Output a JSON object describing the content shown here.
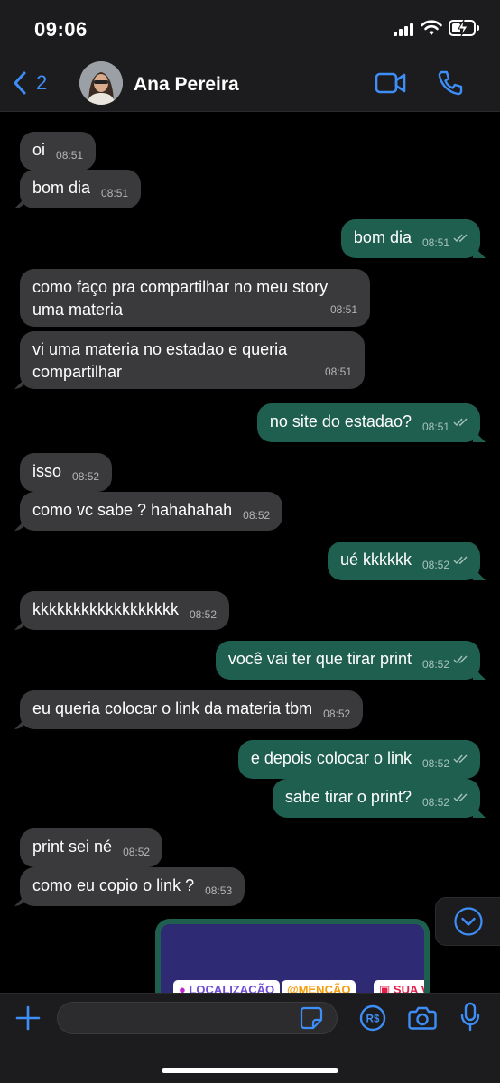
{
  "status_bar": {
    "time": "09:06"
  },
  "header": {
    "back_count": "2",
    "contact_name": "Ana Pereira"
  },
  "messages": [
    {
      "dir": "in",
      "text": "oi",
      "time": "08:51"
    },
    {
      "dir": "in",
      "text": "bom dia",
      "time": "08:51"
    },
    {
      "dir": "out",
      "text": "bom dia",
      "time": "08:51"
    },
    {
      "dir": "in",
      "text": "como faço pra compartilhar no meu story uma materia",
      "time": "08:51"
    },
    {
      "dir": "in",
      "text": "vi uma materia no estadao e queria compartilhar",
      "time": "08:51"
    },
    {
      "dir": "out",
      "text": "no site do estadao?",
      "time": "08:51"
    },
    {
      "dir": "in",
      "text": "isso",
      "time": "08:52"
    },
    {
      "dir": "in",
      "text": "como vc sabe ? hahahahah",
      "time": "08:52"
    },
    {
      "dir": "out",
      "text": "ué kkkkkk",
      "time": "08:52"
    },
    {
      "dir": "in",
      "text": "kkkkkkkkkkkkkkkkkk",
      "time": "08:52"
    },
    {
      "dir": "out",
      "text": "você vai ter que tirar print",
      "time": "08:52"
    },
    {
      "dir": "in",
      "text": "eu queria colocar o link da materia tbm",
      "time": "08:52"
    },
    {
      "dir": "out",
      "text": "e depois colocar o link",
      "time": "08:52"
    },
    {
      "dir": "out",
      "text": "sabe tirar o print?",
      "time": "08:52"
    },
    {
      "dir": "in",
      "text": "print sei né",
      "time": "08:52"
    },
    {
      "dir": "in",
      "text": "como eu copio o link ?",
      "time": "08:53"
    }
  ],
  "image_message": {
    "stickers": [
      "LOCALIZAÇÃO",
      "@MENÇÃO",
      "SUA VEZ"
    ]
  },
  "input": {
    "value": "",
    "placeholder": ""
  },
  "colors": {
    "incoming_bubble": "#3a3a3c",
    "outgoing_bubble": "#1f5f4f",
    "accent": "#3d8ef7"
  }
}
